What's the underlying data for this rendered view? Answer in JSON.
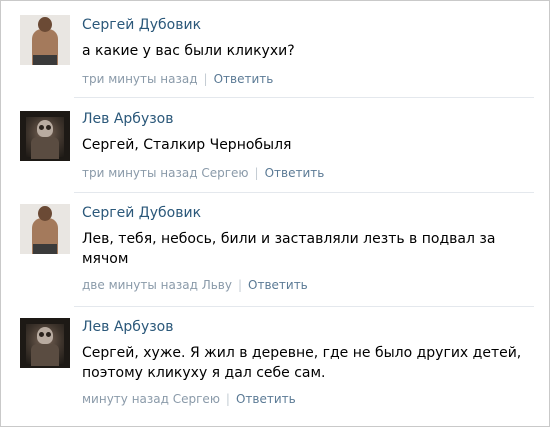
{
  "comments": [
    {
      "author": "Сергей Дубовик",
      "avatar_icon": "shirtless-man-avatar",
      "text": "а какие у вас были кликухи?",
      "time": "три минуты назад",
      "reply": "Ответить"
    },
    {
      "author": "Лев Арбузов",
      "avatar_icon": "stalker-avatar",
      "text": "Сергей, Сталкир Чернобыля",
      "time": "три минуты назад Сергею",
      "reply": "Ответить"
    },
    {
      "author": "Сергей Дубовик",
      "avatar_icon": "shirtless-man-avatar",
      "text": "Лев, тебя, небось, били и заставляли лезть в подвал за мячом",
      "time": "две минуты назад Льву",
      "reply": "Ответить"
    },
    {
      "author": "Лев Арбузов",
      "avatar_icon": "stalker-avatar",
      "text": "Сергей, хуже. Я жил в деревне, где не было других детей, поэтому кликуху я дал себе сам.",
      "time": "минуту назад Сергею",
      "reply": "Ответить"
    }
  ],
  "colors": {
    "author": "#2b587a",
    "meta": "#8a9aa9",
    "reply": "#5b7a95"
  }
}
